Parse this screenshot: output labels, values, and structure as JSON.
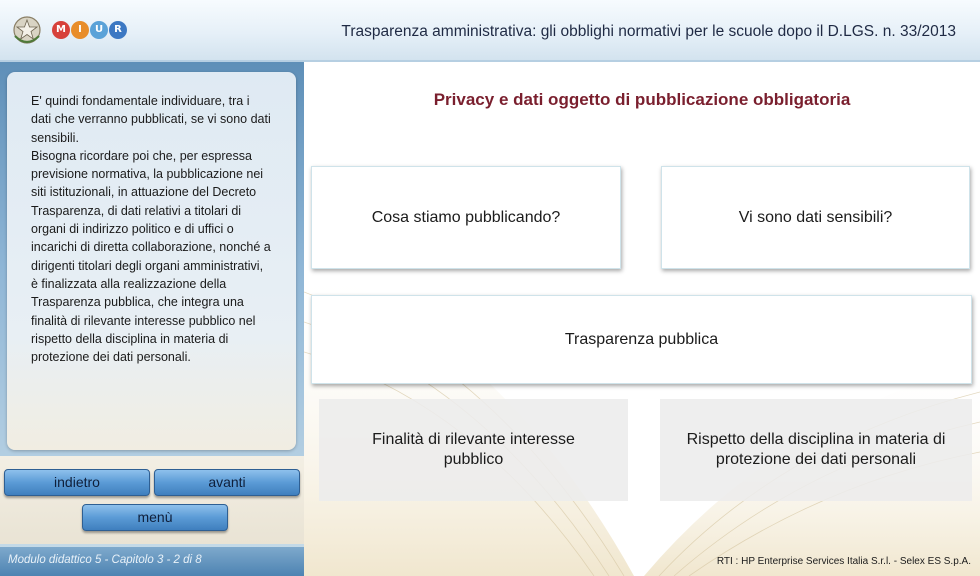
{
  "header": {
    "title": "Trasparenza amministrativa: gli obblighi normativi per le scuole dopo il D.LGS. n. 33/2013",
    "logo_letters": [
      "M",
      "I",
      "U",
      "R"
    ],
    "logo_colors": [
      "#d7413b",
      "#e88d2a",
      "#5aa2d8",
      "#3c78c3"
    ]
  },
  "sidebar": {
    "body_text": "E' quindi fondamentale individuare, tra i dati che verranno pubblicati, se vi sono dati sensibili.\nBisogna ricordare poi che, per espressa previsione normativa, la pubblicazione nei siti istituzionali, in attuazione del Decreto Trasparenza, di dati relativi a titolari di organi di indirizzo politico e di uffici o incarichi di diretta collaborazione, nonché a dirigenti titolari degli organi amministrativi, è finalizzata alla realizzazione della Trasparenza pubblica, che integra una finalità di rilevante interesse pubblico nel rispetto della disciplina in materia di protezione dei dati personali."
  },
  "nav": {
    "back_label": "indietro",
    "next_label": "avanti",
    "menu_label": "menù"
  },
  "footer": {
    "module_label": "Modulo didattico 5 - Capitolo 3 - 2 di 8",
    "credits": "RTI : HP Enterprise Services Italia S.r.l. - Selex ES S.p.A."
  },
  "main": {
    "title": "Privacy e dati oggetto di pubblicazione obbligatoria",
    "cards": {
      "cosa": "Cosa stiamo pubblicando?",
      "sensibili": "Vi sono dati sensibili?",
      "trasparenza": "Trasparenza pubblica",
      "finalita": "Finalità di rilevante interesse pubblico",
      "rispetto": "Rispetto della disciplina in materia di protezione dei dati personali"
    }
  }
}
